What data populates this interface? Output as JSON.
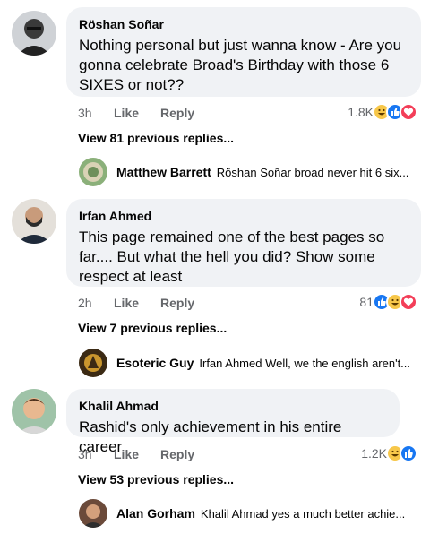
{
  "comments": [
    {
      "author": "Röshan Soñar",
      "text_lines": [
        "Nothing personal but just wanna know - Are you",
        "gonna celebrate Broad's Birthday with those 6",
        "SIXES or not??"
      ],
      "time": "3h",
      "like": "Like",
      "reply": "Reply",
      "reaction_count": "1.8K",
      "reactions": [
        "haha",
        "like",
        "love"
      ],
      "view_more": "View 81 previous replies...",
      "latest_reply": {
        "author": "Matthew Barrett",
        "text": "Röshan Soñar broad never hit 6 six..."
      }
    },
    {
      "author": "Irfan Ahmed",
      "text_lines": [
        "This page remained one of the best pages so",
        "far.... But what the hell you did? Show some",
        "respect at least"
      ],
      "time": "2h",
      "like": "Like",
      "reply": "Reply",
      "reaction_count": "81",
      "reactions": [
        "like",
        "haha",
        "love"
      ],
      "view_more": "View 7 previous replies...",
      "latest_reply": {
        "author": "Esoteric Guy",
        "text": "Irfan Ahmed Well, we the english aren't..."
      }
    },
    {
      "author": "Khalil Ahmad",
      "text_lines": [
        "Rashid's only achievement in his entire career"
      ],
      "time": "3h",
      "like": "Like",
      "reply": "Reply",
      "reaction_count": "1.2K",
      "reactions": [
        "haha",
        "like"
      ],
      "view_more": "View 53 previous replies...",
      "latest_reply": {
        "author": "Alan Gorham",
        "text": "Khalil Ahmad yes a much better achie..."
      }
    }
  ],
  "colors": {
    "bubble": "#f0f2f5",
    "meta": "#65676b",
    "like_blue": "#1877f2",
    "love_red": "#f33e58",
    "haha_yellow": "#f7c74a"
  }
}
